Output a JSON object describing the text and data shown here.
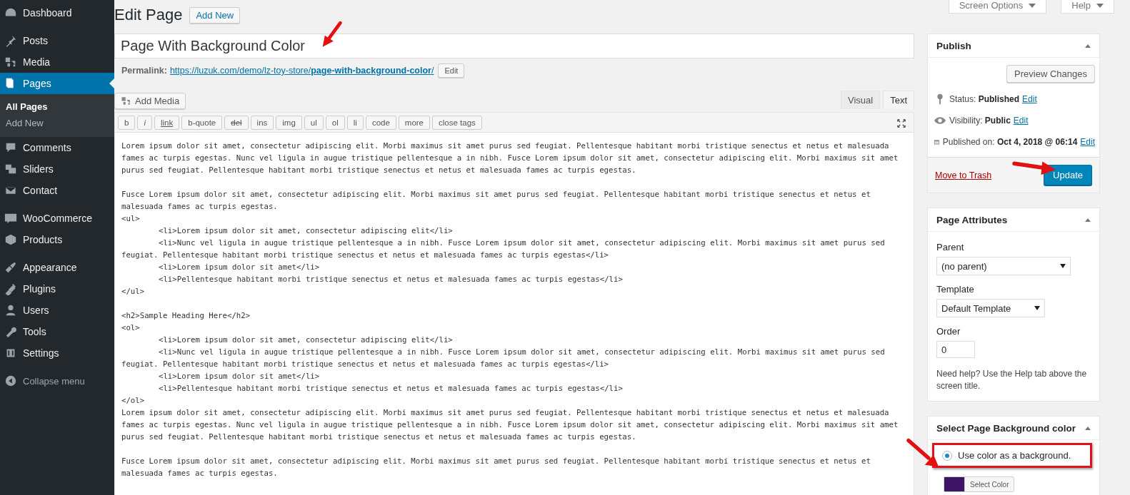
{
  "sidebar": {
    "groups": [
      [
        {
          "label": "Dashboard",
          "selected": false
        }
      ],
      [
        {
          "label": "Posts",
          "selected": false
        },
        {
          "label": "Media",
          "selected": false
        },
        {
          "label": "Pages",
          "selected": true,
          "children": [
            {
              "label": "All Pages",
              "selected": true
            },
            {
              "label": "Add New",
              "selected": false
            }
          ]
        },
        {
          "label": "Comments",
          "selected": false
        },
        {
          "label": "Sliders",
          "selected": false
        },
        {
          "label": "Contact",
          "selected": false
        }
      ],
      [
        {
          "label": "WooCommerce",
          "selected": false
        },
        {
          "label": "Products",
          "selected": false
        }
      ],
      [
        {
          "label": "Appearance",
          "selected": false
        },
        {
          "label": "Plugins",
          "selected": false
        },
        {
          "label": "Users",
          "selected": false
        },
        {
          "label": "Tools",
          "selected": false
        },
        {
          "label": "Settings",
          "selected": false
        }
      ]
    ],
    "collapse": "Collapse menu"
  },
  "top_tabs": [
    "Screen Options",
    "Help"
  ],
  "header": {
    "title": "Edit Page",
    "add_new": "Add New"
  },
  "post_title": "Page With Background Color",
  "permalink": {
    "label": "Permalink:",
    "url_base": "https://luzuk.com/demo/lz-toy-store/",
    "slug": "page-with-background-color",
    "url_end": "/",
    "edit": "Edit"
  },
  "add_media": "Add Media",
  "editor_tabs": [
    {
      "label": "Visual",
      "selected": false
    },
    {
      "label": "Text",
      "selected": true
    }
  ],
  "quicktags": [
    {
      "label": "b",
      "kind": "plain"
    },
    {
      "label": "i",
      "kind": "italic"
    },
    {
      "label": "link",
      "kind": "underline"
    },
    {
      "label": "b-quote",
      "kind": "plain"
    },
    {
      "label": "del",
      "kind": "strike"
    },
    {
      "label": "ins",
      "kind": "plain"
    },
    {
      "label": "img",
      "kind": "plain"
    },
    {
      "label": "ul",
      "kind": "plain"
    },
    {
      "label": "ol",
      "kind": "plain"
    },
    {
      "label": "li",
      "kind": "plain"
    },
    {
      "label": "code",
      "kind": "plain"
    },
    {
      "label": "more",
      "kind": "plain"
    },
    {
      "label": "close tags",
      "kind": "plain"
    }
  ],
  "content_blocks": [
    [
      {
        "text": "Lorem ipsum dolor sit amet, consectetur adipiscing elit. Morbi maximus sit amet purus sed feugiat. Pellentesque habitant morbi tristique senectus et netus et malesuada",
        "indented": false
      },
      {
        "text": "fames ac turpis egestas. Nunc vel ligula in augue tristique pellentesque a in nibh. Fusce Lorem ipsum dolor sit amet, consectetur adipiscing elit. Morbi maximus sit amet",
        "indented": false
      },
      {
        "text": "purus sed feugiat. Pellentesque habitant morbi tristique senectus et netus et malesuada fames ac turpis egestas.",
        "indented": false
      }
    ],
    [
      {
        "text": "Fusce Lorem ipsum dolor sit amet, consectetur adipiscing elit. Morbi maximus sit amet purus sed feugiat. Pellentesque habitant morbi tristique senectus et netus et",
        "indented": false
      },
      {
        "text": "malesuada fames ac turpis egestas.",
        "indented": false
      },
      {
        "text": "<ul>",
        "indented": false
      },
      {
        "text": "<li>Lorem ipsum dolor sit amet, consectetur adipiscing elit</li>",
        "indented": true
      },
      {
        "text": "<li>Nunc vel ligula in augue tristique pellentesque a in nibh. Fusce Lorem ipsum dolor sit amet, consectetur adipiscing elit. Morbi maximus sit amet purus sed",
        "indented": true
      },
      {
        "text": "feugiat. Pellentesque habitant morbi tristique senectus et netus et malesuada fames ac turpis egestas</li>",
        "indented": false
      },
      {
        "text": "<li>Lorem ipsum dolor sit amet</li>",
        "indented": true
      },
      {
        "text": "<li>Pellentesque habitant morbi tristique senectus et netus et malesuada fames ac turpis egestas</li>",
        "indented": true
      },
      {
        "text": "</ul>",
        "indented": false
      }
    ],
    [
      {
        "text": "<h2>Sample Heading Here</h2>",
        "indented": false
      },
      {
        "text": "<ol>",
        "indented": false
      },
      {
        "text": "<li>Lorem ipsum dolor sit amet, consectetur adipiscing elit</li>",
        "indented": true
      },
      {
        "text": "<li>Nunc vel ligula in augue tristique pellentesque a in nibh. Fusce Lorem ipsum dolor sit amet, consectetur adipiscing elit. Morbi maximus sit amet purus sed",
        "indented": true
      },
      {
        "text": "feugiat. Pellentesque habitant morbi tristique senectus et netus et malesuada fames ac turpis egestas</li>",
        "indented": false
      },
      {
        "text": "<li>Lorem ipsum dolor sit amet</li>",
        "indented": true
      },
      {
        "text": "<li>Pellentesque habitant morbi tristique senectus et netus et malesuada fames ac turpis egestas</li>",
        "indented": true
      },
      {
        "text": "</ol>",
        "indented": false
      },
      {
        "text": "Lorem ipsum dolor sit amet, consectetur adipiscing elit. Morbi maximus sit amet purus sed feugiat. Pellentesque habitant morbi tristique senectus et netus et malesuada",
        "indented": false
      },
      {
        "text": "fames ac turpis egestas. Nunc vel ligula in augue tristique pellentesque a in nibh. Fusce Lorem ipsum dolor sit amet, consectetur adipiscing elit. Morbi maximus sit amet",
        "indented": false
      },
      {
        "text": "purus sed feugiat. Pellentesque habitant morbi tristique senectus et netus et malesuada fames ac turpis egestas.",
        "indented": false
      }
    ],
    [
      {
        "text": "Fusce Lorem ipsum dolor sit amet, consectetur adipiscing elit. Morbi maximus sit amet purus sed feugiat. Pellentesque habitant morbi tristique senectus et netus et",
        "indented": false
      },
      {
        "text": "malesuada fames ac turpis egestas.",
        "indented": false
      }
    ]
  ],
  "publish": {
    "title": "Publish",
    "preview": "Preview Changes",
    "rows": [
      {
        "label": "Status:",
        "value": "Published",
        "edit": "Edit"
      },
      {
        "label": "Visibility:",
        "value": "Public",
        "edit": "Edit"
      },
      {
        "label": "Published on:",
        "value": "Oct 4, 2018 @ 06:14",
        "edit": "Edit"
      }
    ],
    "trash": "Move to Trash",
    "update": "Update"
  },
  "page_attributes": {
    "title": "Page Attributes",
    "parent_label": "Parent",
    "parent": "(no parent)",
    "template_label": "Template",
    "template": "Default Template",
    "order_label": "Order",
    "order": "0",
    "help": "Need help? Use the Help tab above the screen title."
  },
  "background": {
    "title": "Select Page Background color",
    "option": "Use color as a background.",
    "checked": true,
    "color": "#3d1566",
    "button": "Select Color"
  }
}
